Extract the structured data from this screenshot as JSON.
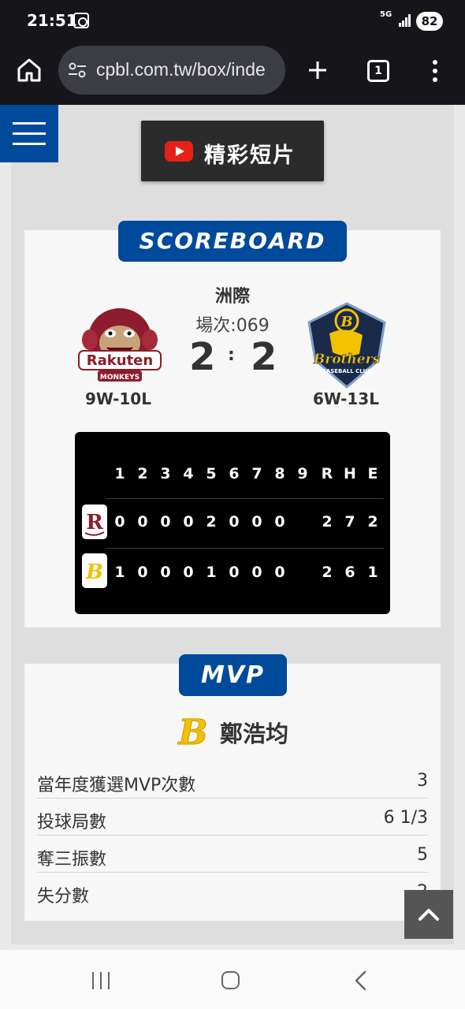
{
  "status_bar": {
    "time": "21:51",
    "network": "5G",
    "battery": "82"
  },
  "browser": {
    "url": "cpbl.com.tw/box/inde",
    "tab_count": "1"
  },
  "highlight_button": {
    "label": "精彩短片"
  },
  "scoreboard": {
    "heading": "SCOREBOARD",
    "venue": "洲際",
    "game_number": "場次:069",
    "away": {
      "name": "Rakuten Monkeys",
      "logo_text": "Rakuten",
      "logo_sub": "MONKEYS",
      "record": "9W-10L",
      "score": "2",
      "color": "#8c1c2e"
    },
    "home": {
      "name": "Brothers",
      "logo_text": "Brothers",
      "logo_sub": "BASEBALL CLUB",
      "record": "6W-13L",
      "score": "2",
      "color": "#f2c200"
    },
    "separator": ":",
    "line_score": {
      "headers": [
        "1",
        "2",
        "3",
        "4",
        "5",
        "6",
        "7",
        "8",
        "9",
        "R",
        "H",
        "E"
      ],
      "rows": [
        {
          "team": "Rakuten Monkeys",
          "badge": "R",
          "innings": [
            "0",
            "0",
            "0",
            "0",
            "2",
            "0",
            "0",
            "0",
            "",
            ""
          ],
          "r": "2",
          "h": "7",
          "e": "2"
        },
        {
          "team": "Brothers",
          "badge": "B",
          "innings": [
            "1",
            "0",
            "0",
            "0",
            "1",
            "0",
            "0",
            "0",
            "",
            ""
          ],
          "r": "2",
          "h": "6",
          "e": "1"
        }
      ]
    }
  },
  "mvp": {
    "heading": "MVP",
    "player_name": "鄭浩均",
    "stats": [
      {
        "label": "當年度獲選MVP次數",
        "value": "3"
      },
      {
        "label": "投球局數",
        "value": "6 1/3"
      },
      {
        "label": "奪三振數",
        "value": "5"
      },
      {
        "label": "失分數",
        "value": "2"
      }
    ]
  },
  "colors": {
    "brand_blue": "#004a9c",
    "dark": "#2b2b2b",
    "brothers_yellow": "#f2c200",
    "monkeys_red": "#8c1c2e"
  }
}
